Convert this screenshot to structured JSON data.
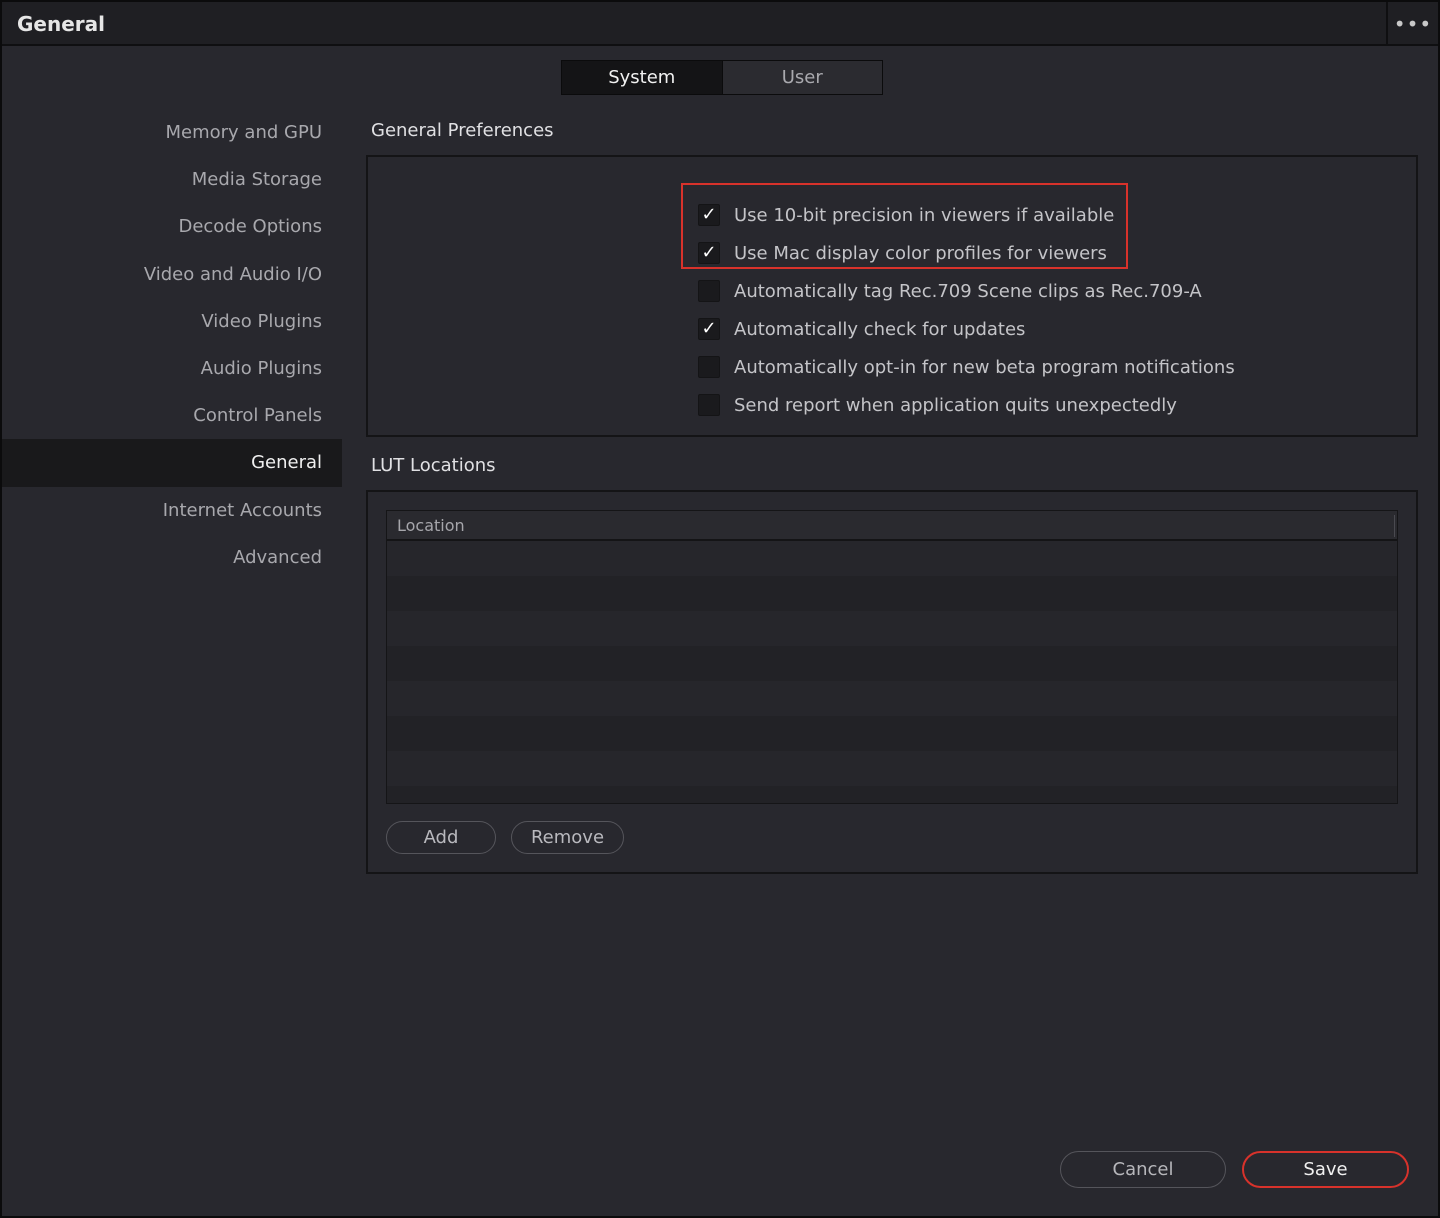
{
  "window": {
    "title": "General",
    "more_label": "•••"
  },
  "tabs": [
    {
      "label": "System",
      "active": true
    },
    {
      "label": "User",
      "active": false
    }
  ],
  "sidebar": {
    "items": [
      {
        "label": "Memory and GPU"
      },
      {
        "label": "Media Storage"
      },
      {
        "label": "Decode Options"
      },
      {
        "label": "Video and Audio I/O"
      },
      {
        "label": "Video Plugins"
      },
      {
        "label": "Audio Plugins"
      },
      {
        "label": "Control Panels"
      },
      {
        "label": "General",
        "selected": true
      },
      {
        "label": "Internet Accounts"
      },
      {
        "label": "Advanced"
      }
    ]
  },
  "general_preferences": {
    "title": "General Preferences",
    "options": [
      {
        "label": "Use 10-bit precision in viewers if available",
        "checked": true
      },
      {
        "label": "Use Mac display color profiles for viewers",
        "checked": true
      },
      {
        "label": "Automatically tag Rec.709 Scene clips as Rec.709-A",
        "checked": false
      },
      {
        "label": "Automatically check for updates",
        "checked": true
      },
      {
        "label": "Automatically opt-in for new beta program notifications",
        "checked": false
      },
      {
        "label": "Send report when application quits unexpectedly",
        "checked": false
      }
    ],
    "highlight_color": "#d8322b"
  },
  "lut_locations": {
    "title": "LUT Locations",
    "column_header": "Location",
    "rows": [],
    "add_label": "Add",
    "remove_label": "Remove"
  },
  "footer": {
    "cancel_label": "Cancel",
    "save_label": "Save"
  },
  "colors": {
    "accent": "#d8322b",
    "background": "#28282e",
    "titlebar": "#1f1f23"
  },
  "icons": {
    "checkmark": "check-icon",
    "more": "more-horizontal-icon"
  }
}
